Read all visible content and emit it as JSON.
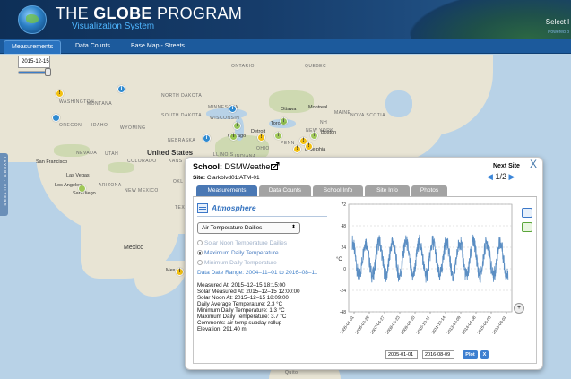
{
  "header": {
    "title_plain": "THE ",
    "title_bold": "GLOBE",
    "title_rest": " PROGRAM",
    "subtitle": "Visualization System",
    "select_link": "Select l",
    "powered_by": "Powered b"
  },
  "nav": {
    "tabs": [
      {
        "label": "Measurements"
      },
      {
        "label": "Data Counts"
      },
      {
        "label": "Base Map - Streets"
      }
    ]
  },
  "date_control": {
    "value": "2015-12-15",
    "slider_position": 0.85
  },
  "side_tab_label": "LAYERS · FILTERS",
  "map_labels": {
    "ontario": "ONTARIO",
    "quebec": "QUEBEC",
    "north_dakota": "NORTH DAKOTA",
    "minnesota": "MINNESOTA",
    "montana": "MONTANA",
    "south_dakota": "SOUTH DAKOTA",
    "wisconsin": "WISCONSIN",
    "idaho": "IDAHO",
    "wyoming": "WYOMING",
    "oregon": "OREGON",
    "washington": "WASHINGTON",
    "nebraska": "NEBRASKA",
    "nevada": "NEVADA",
    "utah": "UTAH",
    "colorado": "COLORADO",
    "kansas": "KANS",
    "united_states": "United States",
    "illinois": "ILLINOIS",
    "indiana": "INDIANA",
    "ohio": "OHIO",
    "arizona": "ARIZONA",
    "new_mexico": "NEW MEXICO",
    "oklahoma": "OKL",
    "texas": "TEXA",
    "mexico": "Mexico",
    "mexico_city": "Mex",
    "penn": "PENN",
    "new_york": "NEW YORK",
    "maine": "MAINE",
    "nova_scotia": "NOVA SCOTIA",
    "nh": "NH",
    "quito": "Quito",
    "san_francisco": "San Francisco",
    "las_vegas": "Las Vegas",
    "los_angeles": "Los Angeles",
    "san_diego": "San Diego",
    "chicago": "Chicago",
    "detroit": "Detroit",
    "toronto": "Toronto",
    "ottawa": "Ottawa",
    "montreal": "Montreal",
    "boston": "Boston",
    "philadelphia": "iladelphia"
  },
  "popup": {
    "school_label": "School:",
    "school_name": "DSMWeather",
    "site_label": "Site:",
    "site_name": "Clarkblvd01:ATM-01",
    "next_site_label": "Next Site",
    "pager_text": "1/2",
    "close_label": "X",
    "tabs": [
      {
        "label": "Measurements"
      },
      {
        "label": "Data Counts"
      },
      {
        "label": "School Info"
      },
      {
        "label": "Site Info"
      },
      {
        "label": "Photos"
      }
    ],
    "section_title": "Atmosphere",
    "dataset_select": "Air Temperature Dailies",
    "radio_options": [
      {
        "label": "Solar Noon Temperature Dailies",
        "selected": false
      },
      {
        "label": "Maximum Daily Temperature",
        "selected": true
      },
      {
        "label": "Minimum Daily Temperature",
        "selected": false
      }
    ],
    "date_range": "Data Date Range: 2004–11–01 to 2016–08–11",
    "details": [
      "Measured At: 2015–12–15 18:15:00",
      "Solar Measured At: 2015–12–15 12:00:00",
      "Solar Noon At: 2015–12–15 18:09:00",
      "Daily Average Temperature: 2.3 °C",
      "Minimum Daily Temperature: 1.3 °C",
      "Maximum Daily Temperature: 3.7 °C",
      "Comments: air temp subday rollup",
      "Elevation: 291.40 m"
    ],
    "start_date": "2005-01-01",
    "end_date": "2016-08-09",
    "plot_label": "Plot",
    "clear_label": "X",
    "zoom_label": "+"
  },
  "chart_data": {
    "type": "line",
    "ylabel": "°C",
    "y_ticks": [
      "72",
      "48",
      "24",
      "0",
      "-24",
      "-48"
    ],
    "ylim": [
      -48,
      72
    ],
    "x_ticks": [
      "2005-01-01",
      "2006-02-28",
      "2007-04-27",
      "2008-06-23",
      "2009-08-20",
      "2010-10-17",
      "2011-12-14",
      "2013-02-09",
      "2014-04-08",
      "2015-06-05",
      "2016-08-01"
    ],
    "series": [
      {
        "color": "#5b8ec3",
        "description_min": -14,
        "description_max": 36,
        "cycles": 11.6
      }
    ],
    "grid": true
  },
  "colors": {
    "accent": "#4a78b4",
    "nav": "#1c5a9c"
  }
}
